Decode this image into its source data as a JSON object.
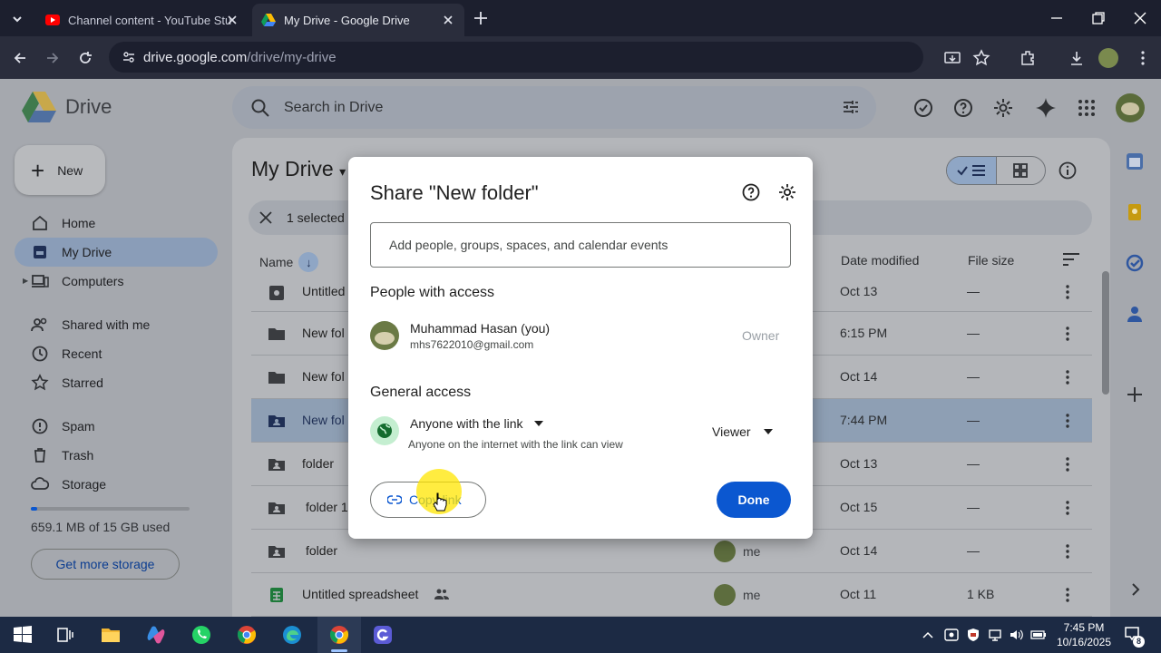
{
  "browser": {
    "tabs": [
      {
        "title": "Channel content - YouTube Stu",
        "icon": "youtube-icon"
      },
      {
        "title": "My Drive - Google Drive",
        "icon": "drive-icon",
        "active": true
      }
    ],
    "url_domain": "drive.google.com",
    "url_path": "/drive/my-drive"
  },
  "app": {
    "name": "Drive",
    "search_placeholder": "Search in Drive",
    "new_label": "New"
  },
  "sidebar": {
    "items": [
      {
        "label": "Home",
        "icon": "home-icon"
      },
      {
        "label": "My Drive",
        "icon": "my-drive-icon",
        "selected": true
      },
      {
        "label": "Computers",
        "icon": "computers-icon"
      },
      {
        "label": "Shared with me",
        "icon": "shared-icon"
      },
      {
        "label": "Recent",
        "icon": "clock-icon"
      },
      {
        "label": "Starred",
        "icon": "star-icon"
      },
      {
        "label": "Spam",
        "icon": "spam-icon"
      },
      {
        "label": "Trash",
        "icon": "trash-icon"
      },
      {
        "label": "Storage",
        "icon": "cloud-icon"
      }
    ],
    "storage_text": "659.1 MB of 15 GB used",
    "storage_fraction": 0.04,
    "get_more": "Get more storage"
  },
  "main": {
    "title": "My Drive",
    "selection_text": "1 selected",
    "columns": {
      "name": "Name",
      "date": "Date modified",
      "size": "File size"
    },
    "rows": [
      {
        "name": "Untitled",
        "date": "Oct 13",
        "size": "—",
        "owner": "",
        "icon": "shared-drive-icon"
      },
      {
        "name": "New fol",
        "date": "6:15 PM",
        "size": "—",
        "owner": "",
        "icon": "folder-icon"
      },
      {
        "name": "New fol",
        "date": "Oct 14",
        "size": "—",
        "owner": "",
        "icon": "folder-icon"
      },
      {
        "name": "New fol",
        "date": "7:44 PM",
        "size": "—",
        "owner": "",
        "icon": "shared-folder-icon",
        "selected": true
      },
      {
        "name": "folder",
        "date": "Oct 13",
        "size": "—",
        "owner": "",
        "icon": "shared-folder-icon"
      },
      {
        "name": "folder 1",
        "date": "Oct 15",
        "size": "—",
        "owner": "",
        "icon": "shared-folder-icon"
      },
      {
        "name": "folder",
        "date": "Oct 14",
        "size": "—",
        "owner": "me",
        "icon": "shared-folder-icon"
      },
      {
        "name": "Untitled spreadsheet",
        "date": "Oct 11",
        "size": "1 KB",
        "owner": "me",
        "icon": "sheets-icon"
      }
    ]
  },
  "dialog": {
    "title": "Share \"New folder\"",
    "add_placeholder": "Add people, groups, spaces, and calendar events",
    "people_heading": "People with access",
    "person_name": "Muhammad Hasan (you)",
    "person_email": "mhs7622010@gmail.com",
    "person_role": "Owner",
    "general_heading": "General access",
    "access_type": "Anyone with the link",
    "access_desc": "Anyone on the internet with the link can view",
    "access_role": "Viewer",
    "copy_link": "Copy link",
    "done": "Done"
  },
  "taskbar": {
    "time": "7:45 PM",
    "date": "10/16/2025",
    "notifications": "8"
  },
  "colors": {
    "accent": "#0b57d0",
    "selected_row": "#8e9fb4",
    "globe_bg": "#c4eed0"
  }
}
